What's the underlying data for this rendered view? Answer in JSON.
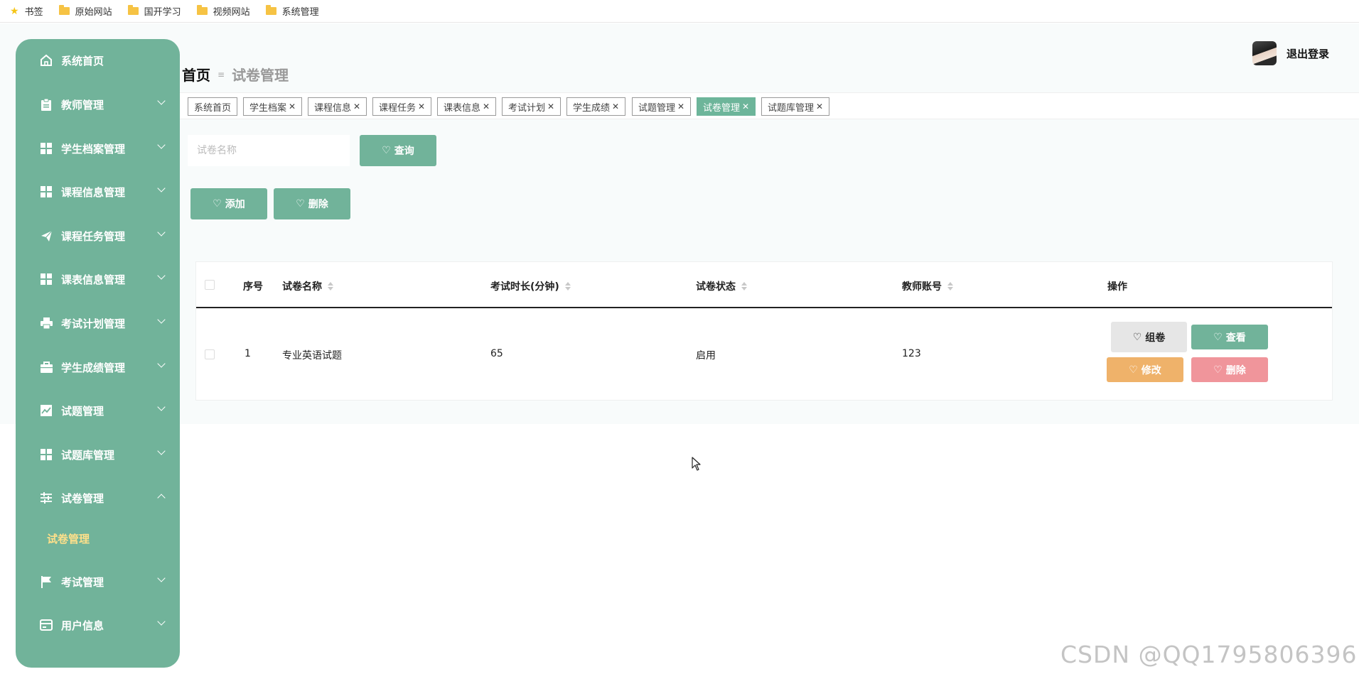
{
  "bookmarks": [
    {
      "label": "书签",
      "icon": "star-icon"
    },
    {
      "label": "原始网站",
      "icon": "folder-icon"
    },
    {
      "label": "国开学习",
      "icon": "folder-icon"
    },
    {
      "label": "视频网站",
      "icon": "folder-icon"
    },
    {
      "label": "系统管理",
      "icon": "folder-icon"
    }
  ],
  "sidebar": {
    "items": [
      {
        "label": "系统首页",
        "icon": "home-icon"
      },
      {
        "label": "教师管理",
        "icon": "clipboard-icon"
      },
      {
        "label": "学生档案管理",
        "icon": "grid-icon"
      },
      {
        "label": "课程信息管理",
        "icon": "grid-icon"
      },
      {
        "label": "课程任务管理",
        "icon": "send-icon"
      },
      {
        "label": "课表信息管理",
        "icon": "grid-icon"
      },
      {
        "label": "考试计划管理",
        "icon": "printer-icon"
      },
      {
        "label": "学生成绩管理",
        "icon": "briefcase-icon"
      },
      {
        "label": "试题管理",
        "icon": "chart-icon"
      },
      {
        "label": "试题库管理",
        "icon": "grid-icon"
      },
      {
        "label": "试卷管理",
        "icon": "sliders-icon"
      },
      {
        "label": "考试管理",
        "icon": "flag-icon"
      },
      {
        "label": "用户信息",
        "icon": "card-icon"
      }
    ],
    "sub_item": "试卷管理"
  },
  "header": {
    "home": "首页",
    "separator": "≡",
    "current": "试卷管理",
    "logout": "退出登录"
  },
  "tabs": [
    {
      "label": "系统首页",
      "closable": false
    },
    {
      "label": "学生档案",
      "closable": true
    },
    {
      "label": "课程信息",
      "closable": true
    },
    {
      "label": "课程任务",
      "closable": true
    },
    {
      "label": "课表信息",
      "closable": true
    },
    {
      "label": "考试计划",
      "closable": true
    },
    {
      "label": "学生成绩",
      "closable": true
    },
    {
      "label": "试题管理",
      "closable": true
    },
    {
      "label": "试卷管理",
      "closable": true,
      "active": true
    },
    {
      "label": "试题库管理",
      "closable": true
    }
  ],
  "search": {
    "placeholder": "试卷名称",
    "button": "查询"
  },
  "actions": {
    "add": "添加",
    "delete": "删除"
  },
  "table": {
    "columns": [
      "序号",
      "试卷名称",
      "考试时长(分钟)",
      "试卷状态",
      "教师账号",
      "操作"
    ],
    "rows": [
      {
        "index": "1",
        "name": "专业英语试题",
        "duration": "65",
        "status": "启用",
        "teacher": "123"
      }
    ],
    "row_actions": {
      "compose": "组卷",
      "view": "查看",
      "edit": "修改",
      "delete": "删除"
    }
  },
  "watermark": "CSDN @QQ1795806396",
  "colors": {
    "primary": "#71b39a",
    "orange": "#efb26a",
    "pink": "#f0959b",
    "gray": "#e6e6e6",
    "submenu_active": "#ffe08a"
  }
}
